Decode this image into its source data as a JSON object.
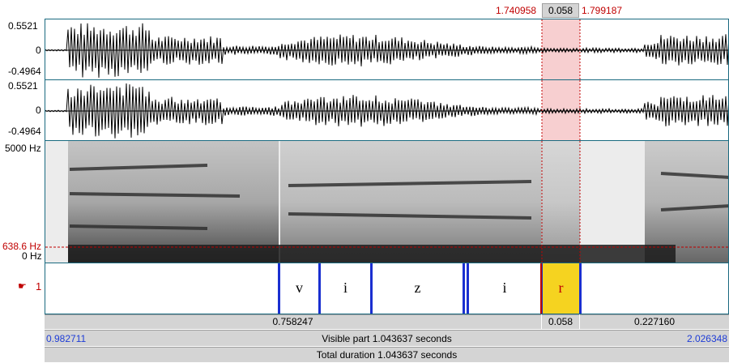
{
  "selection": {
    "start": "1.740958",
    "end": "1.799187",
    "duration": "0.058"
  },
  "waveform": {
    "channel1": {
      "max": "0.5521",
      "zero": "0",
      "min": "-0.4964"
    },
    "channel2": {
      "max": "0.5521",
      "zero": "0",
      "min": "-0.4964"
    }
  },
  "spectrogram": {
    "top_freq": "5000 Hz",
    "cursor_freq": "638.6 Hz",
    "bottom_freq": "0 Hz"
  },
  "tier": {
    "number": "1",
    "intervals": [
      {
        "label": "v"
      },
      {
        "label": "i"
      },
      {
        "label": "z"
      },
      {
        "label": "i"
      },
      {
        "label": "r"
      }
    ]
  },
  "duration_bar": {
    "left": "0.758247",
    "middle": "0.058",
    "right": "0.227160"
  },
  "visible_bar": {
    "start": "0.982711",
    "label": "Visible part 1.043637 seconds",
    "end": "2.026348"
  },
  "total_bar": {
    "label": "Total duration 1.043637 seconds"
  },
  "colors": {
    "selection_fill": "#f7cfd0",
    "selected_interval": "#f5d320",
    "boundary": "#1a2fd0",
    "cursor": "#c00000"
  }
}
